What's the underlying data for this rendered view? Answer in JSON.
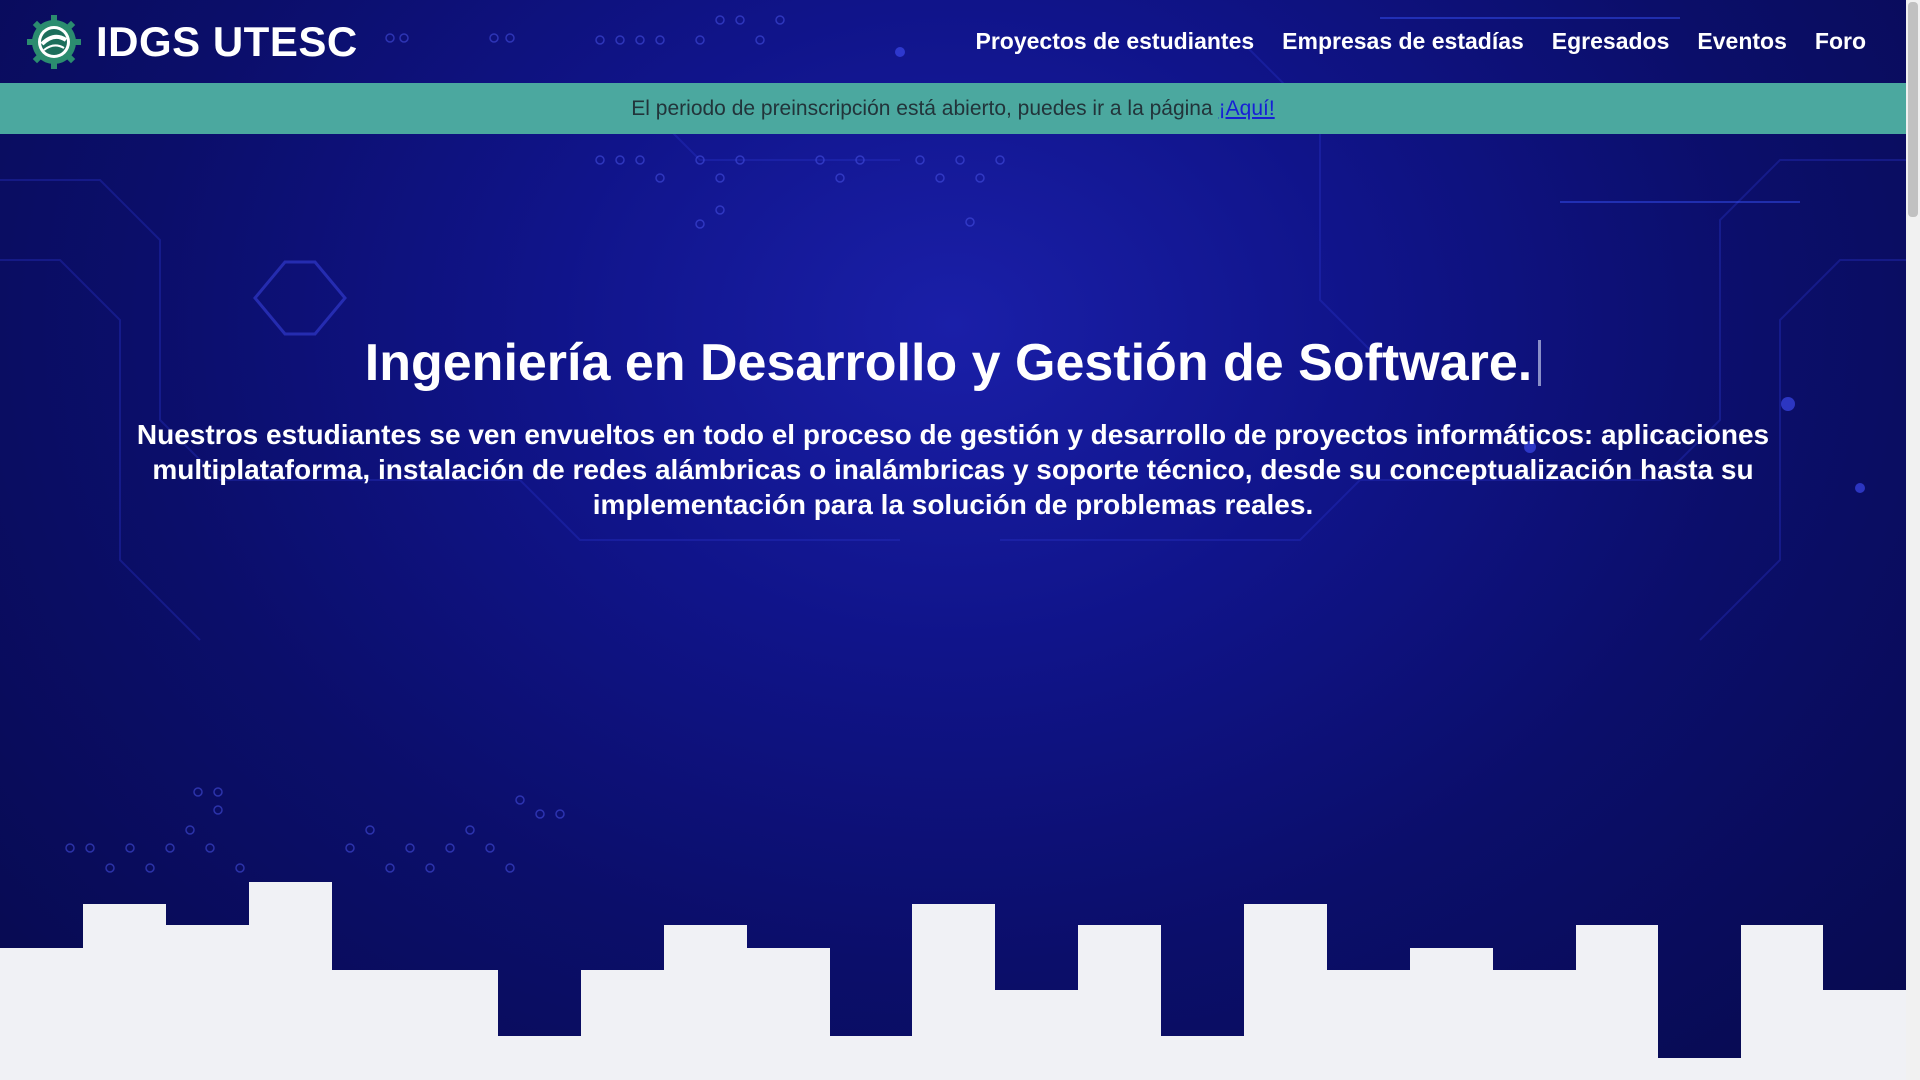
{
  "brand": {
    "name": "IDGS UTESC",
    "logo_icon": "utesc-gear-logo-icon"
  },
  "nav": {
    "items": [
      {
        "label": "Proyectos de estudiantes"
      },
      {
        "label": "Empresas de estadías"
      },
      {
        "label": "Egresados"
      },
      {
        "label": "Eventos"
      },
      {
        "label": "Foro"
      }
    ]
  },
  "banner": {
    "text": "El periodo de preinscripción está abierto, puedes ir a la página",
    "link_label": "¡Aquí!"
  },
  "hero": {
    "title": "Ingeniería en Desarrollo y Gestión de Software.",
    "description": "Nuestros estudiantes se ven envueltos en todo el proceso de gestión y desarrollo de proyectos informáticos: aplicaciones multiplataforma, instalación de redes alámbricas o inalámbricas y soporte técnico, desde su conceptualización hasta su implementación para la solución de problemas reales."
  },
  "colors": {
    "background": "#0b0e6a",
    "banner": "#4ba89f",
    "skyline": "#f0f1f5",
    "link": "#1620d6"
  }
}
